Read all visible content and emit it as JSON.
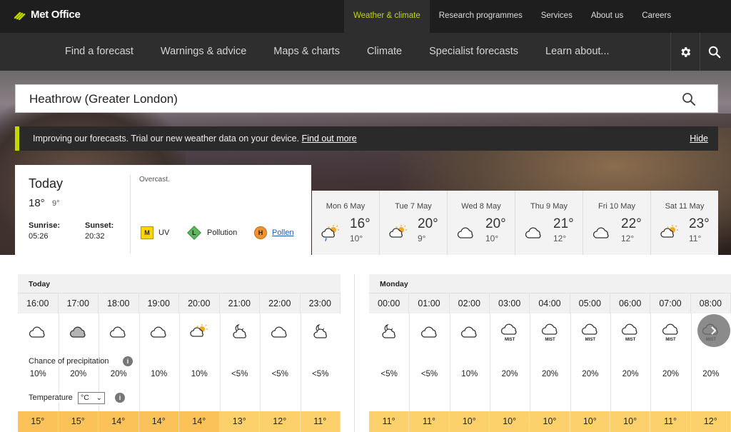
{
  "brand": {
    "name": "Met Office"
  },
  "top_links": [
    "Weather & climate",
    "Research programmes",
    "Services",
    "About us",
    "Careers"
  ],
  "main_nav": [
    "Find a forecast",
    "Warnings & advice",
    "Maps & charts",
    "Climate",
    "Specialist forecasts",
    "Learn about..."
  ],
  "search": {
    "value": "Heathrow (Greater London)"
  },
  "banner": {
    "text": "Improving our forecasts. Trial our new weather data on your device.",
    "link": "Find out more",
    "hide": "Hide"
  },
  "today": {
    "title": "Today",
    "high": "18°",
    "low": "9°",
    "sunrise_label": "Sunrise:",
    "sunrise": "05:26",
    "sunset_label": "Sunset:",
    "sunset": "20:32",
    "summary": "Overcast.",
    "uv_badge": "M",
    "uv_label": "UV",
    "pollution_badge": "L",
    "pollution_label": "Pollution",
    "pollen_badge": "H",
    "pollen_label": "Pollen"
  },
  "days": [
    {
      "name": "Mon 6 May",
      "high": "16°",
      "low": "10°",
      "icon": "sun-cloud-rain-icon"
    },
    {
      "name": "Tue 7 May",
      "high": "20°",
      "low": "9°",
      "icon": "sun-cloud-icon"
    },
    {
      "name": "Wed 8 May",
      "high": "20°",
      "low": "10°",
      "icon": "cloud-icon"
    },
    {
      "name": "Thu 9 May",
      "high": "21°",
      "low": "12°",
      "icon": "cloud-icon"
    },
    {
      "name": "Fri 10 May",
      "high": "22°",
      "low": "12°",
      "icon": "cloud-icon"
    },
    {
      "name": "Sat 11 May",
      "high": "23°",
      "low": "11°",
      "icon": "sun-cloud-icon"
    }
  ],
  "hourly_today": {
    "label": "Today",
    "times": [
      "16:00",
      "17:00",
      "18:00",
      "19:00",
      "20:00",
      "21:00",
      "22:00",
      "23:00"
    ],
    "icons": [
      "cloud-icon",
      "grey-cloud-icon",
      "cloud-icon",
      "cloud-icon",
      "sun-cloud-icon",
      "moon-cloud-icon",
      "cloud-icon",
      "moon-cloud-icon"
    ],
    "precip": [
      "10%",
      "20%",
      "20%",
      "10%",
      "10%",
      "<5%",
      "<5%",
      "<5%"
    ],
    "temps": [
      "15°",
      "15°",
      "14°",
      "14°",
      "14°",
      "13°",
      "12°",
      "11°"
    ]
  },
  "hourly_monday": {
    "label": "Monday",
    "times": [
      "00:00",
      "01:00",
      "02:00",
      "03:00",
      "04:00",
      "05:00",
      "06:00",
      "07:00",
      "08:00"
    ],
    "icons": [
      "moon-cloud-icon",
      "cloud-icon",
      "cloud-icon",
      "mist-icon",
      "mist-icon",
      "mist-icon",
      "mist-icon",
      "mist-icon",
      "mist-icon"
    ],
    "mist": [
      "",
      "",
      "",
      "MIST",
      "MIST",
      "MIST",
      "MIST",
      "MIST",
      "MIST"
    ],
    "precip": [
      "<5%",
      "<5%",
      "10%",
      "20%",
      "20%",
      "20%",
      "20%",
      "20%",
      "20%"
    ],
    "temps": [
      "11°",
      "11°",
      "10°",
      "10°",
      "10°",
      "10°",
      "10°",
      "11°",
      "12°"
    ]
  },
  "labels": {
    "precip": "Chance of precipitation",
    "temperature": "Temperature",
    "unit": "°C"
  },
  "colors": {
    "accent": "#c2d600",
    "temp_warm": "#fbc259",
    "temp_mild": "#fcd06a",
    "uv": "#ffd400",
    "pollution": "#5bb85d",
    "pollen": "#f4922f"
  }
}
